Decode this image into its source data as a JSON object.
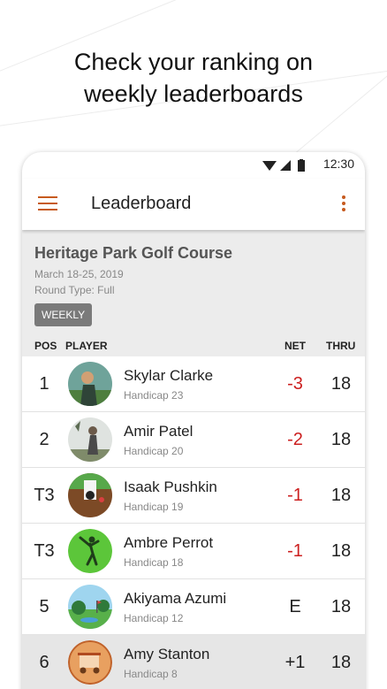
{
  "promo": {
    "line1": "Check your ranking on",
    "line2": "weekly leaderboards"
  },
  "status_bar": {
    "time": "12:30",
    "icons": [
      "wifi-icon",
      "signal-icon",
      "battery-icon"
    ]
  },
  "app_bar": {
    "title": "Leaderboard",
    "menu_icon": "hamburger-icon",
    "more_icon": "more-vert-icon"
  },
  "course": {
    "name": "Heritage Park Golf Course",
    "dates": "March 18-25, 2019",
    "round_type": "Round Type: Full",
    "badge": "WEEKLY"
  },
  "columns": {
    "pos": "POS",
    "player": "PLAYER",
    "net": "NET",
    "thru": "THRU"
  },
  "rows": [
    {
      "pos": "1",
      "name": "Skylar Clarke",
      "handicap": "Handicap 23",
      "net": "-3",
      "thru": "18"
    },
    {
      "pos": "2",
      "name": "Amir Patel",
      "handicap": "Handicap 20",
      "net": "-2",
      "thru": "18"
    },
    {
      "pos": "T3",
      "name": "Isaak Pushkin",
      "handicap": "Handicap 19",
      "net": "-1",
      "thru": "18"
    },
    {
      "pos": "T3",
      "name": "Ambre Perrot",
      "handicap": "Handicap 18",
      "net": "-1",
      "thru": "18"
    },
    {
      "pos": "5",
      "name": "Akiyama Azumi",
      "handicap": "Handicap 12",
      "net": "E",
      "thru": "18"
    },
    {
      "pos": "6",
      "name": "Amy Stanton",
      "handicap": "Handicap 8",
      "net": "+1",
      "thru": "18"
    }
  ],
  "colors": {
    "accent": "#c65a1e",
    "negative": "#cc1f1f",
    "header_bg": "#ececec"
  }
}
